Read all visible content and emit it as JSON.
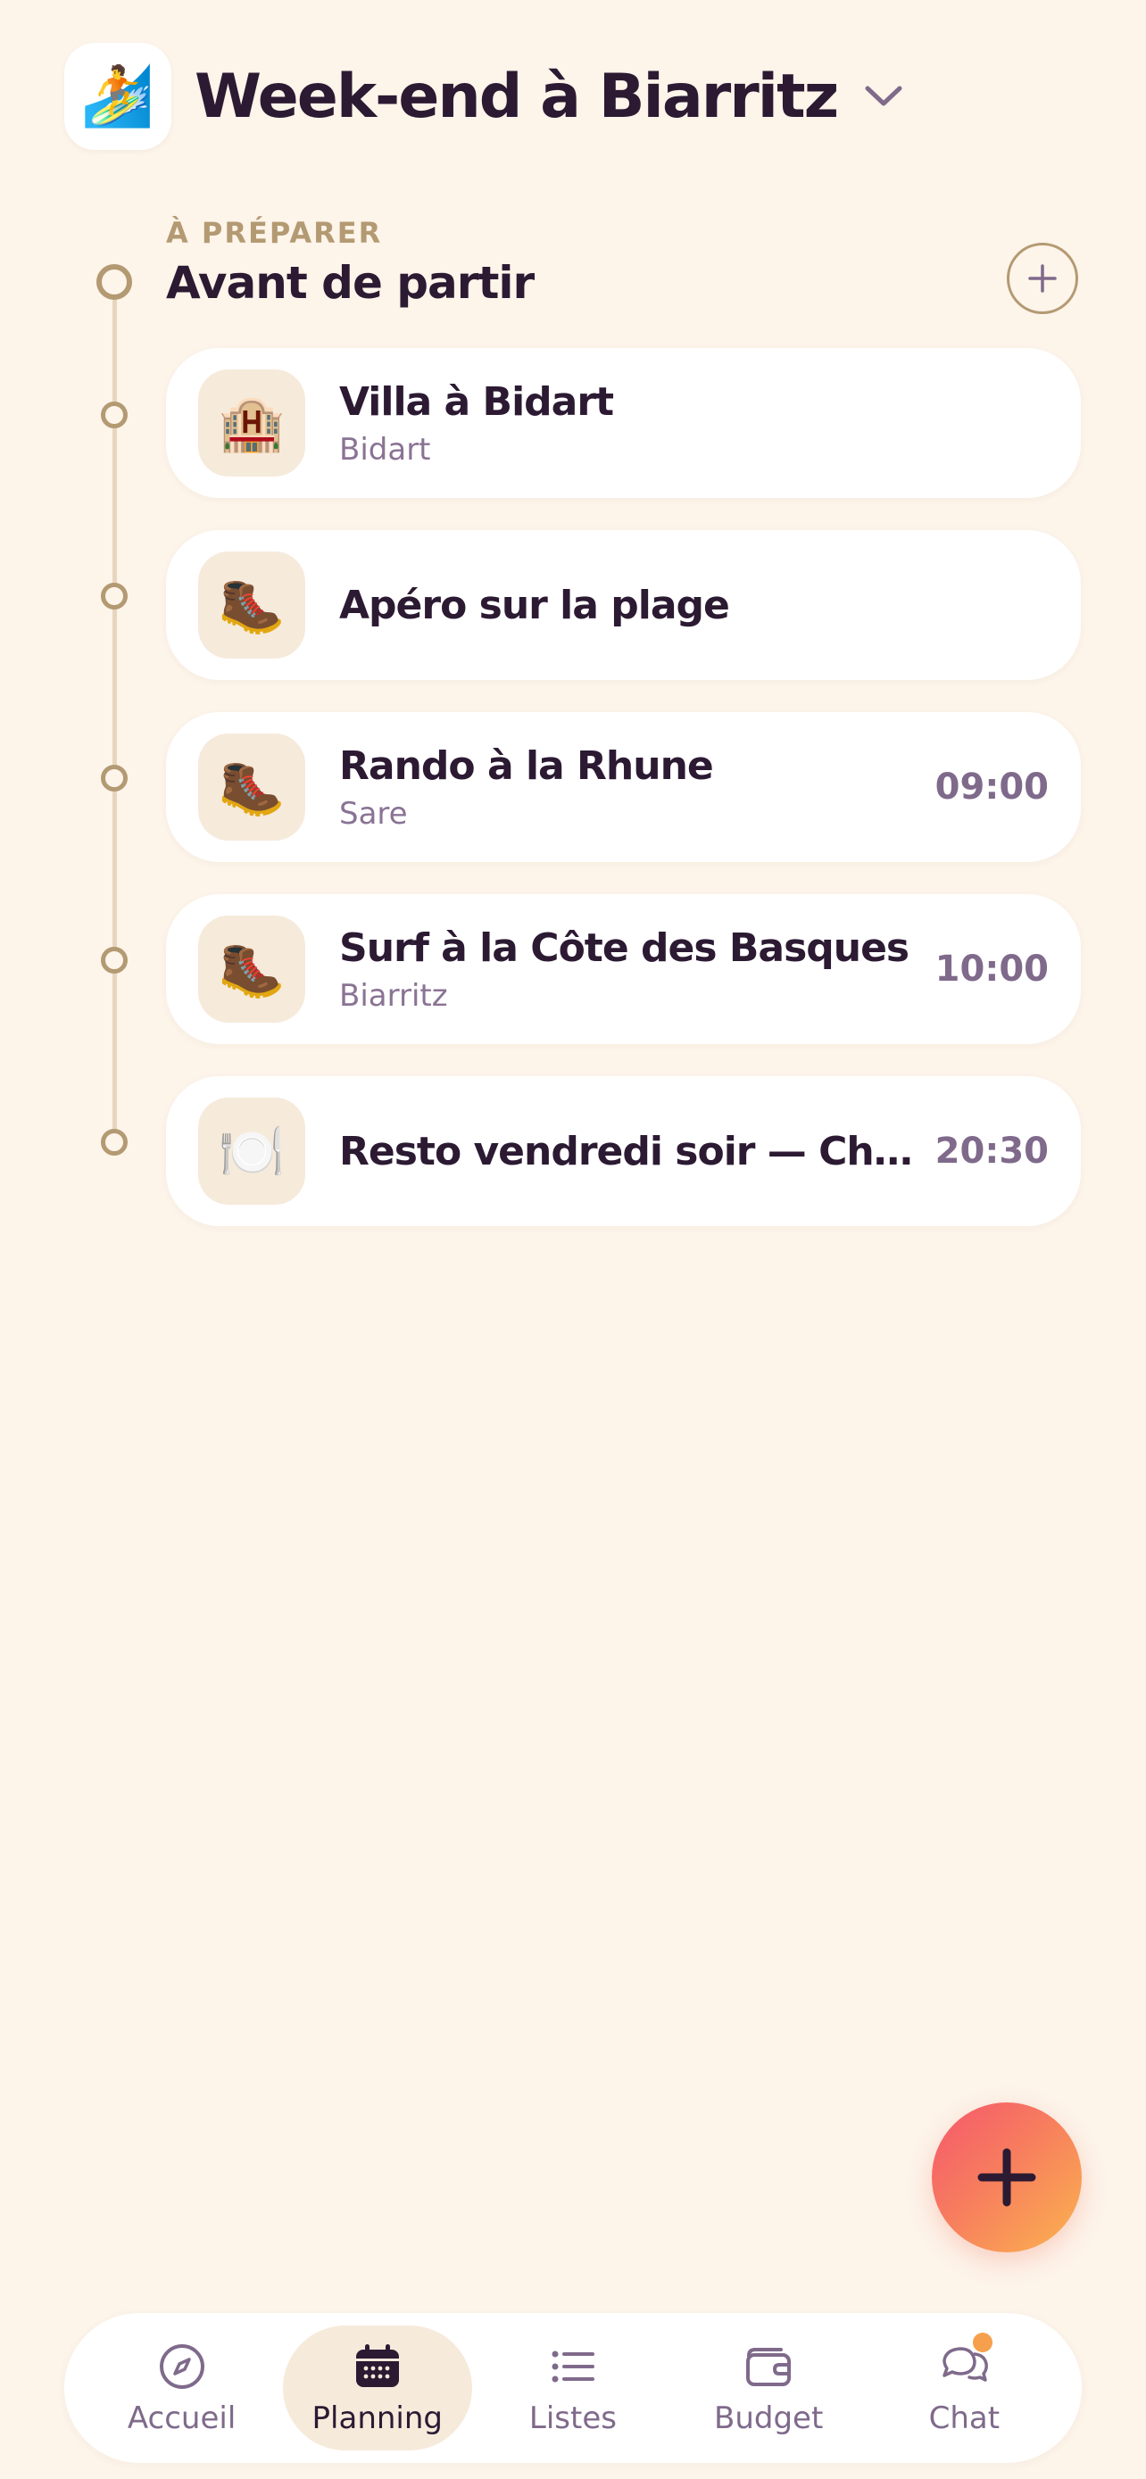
{
  "trip": {
    "icon": "🏄",
    "icon_name": "surfer-icon",
    "title": "Week-end à Biarritz"
  },
  "section": {
    "eyebrow": "À PRÉPARER",
    "title": "Avant de partir"
  },
  "items": [
    {
      "icon": "🏨",
      "icon_name": "hotel-icon",
      "title": "Villa à Bidart",
      "subtitle": "Bidart",
      "time": ""
    },
    {
      "icon": "🥾",
      "icon_name": "hiking-boot-icon",
      "title": "Apéro sur la plage",
      "subtitle": "",
      "time": ""
    },
    {
      "icon": "🥾",
      "icon_name": "hiking-boot-icon",
      "title": "Rando à la Rhune",
      "subtitle": "Sare",
      "time": "09:00"
    },
    {
      "icon": "🥾",
      "icon_name": "hiking-boot-icon",
      "title": "Surf à la Côte des Basques",
      "subtitle": "Biarritz",
      "time": "10:00"
    },
    {
      "icon": "🍽️",
      "icon_name": "plate-cutlery-icon",
      "title": "Resto vendredi soir — Chez ...",
      "subtitle": "",
      "time": "20:30"
    }
  ],
  "nav": {
    "items": [
      {
        "label": "Accueil",
        "icon_name": "compass-icon",
        "active": false
      },
      {
        "label": "Planning",
        "icon_name": "calendar-icon",
        "active": true
      },
      {
        "label": "Listes",
        "icon_name": "list-icon",
        "active": false
      },
      {
        "label": "Budget",
        "icon_name": "wallet-icon",
        "active": false
      },
      {
        "label": "Chat",
        "icon_name": "chat-bubbles-icon",
        "active": false,
        "has_notification": true
      }
    ]
  },
  "colors": {
    "background": "#fdf4ea",
    "text_primary": "#2c1a33",
    "text_secondary": "#8a7394",
    "accent_gold": "#b39a72",
    "card_icon_bg": "#f6eadb",
    "fab_gradient_start": "#f5576c",
    "fab_gradient_end": "#fbb44f",
    "notification": "#f6a04d"
  }
}
